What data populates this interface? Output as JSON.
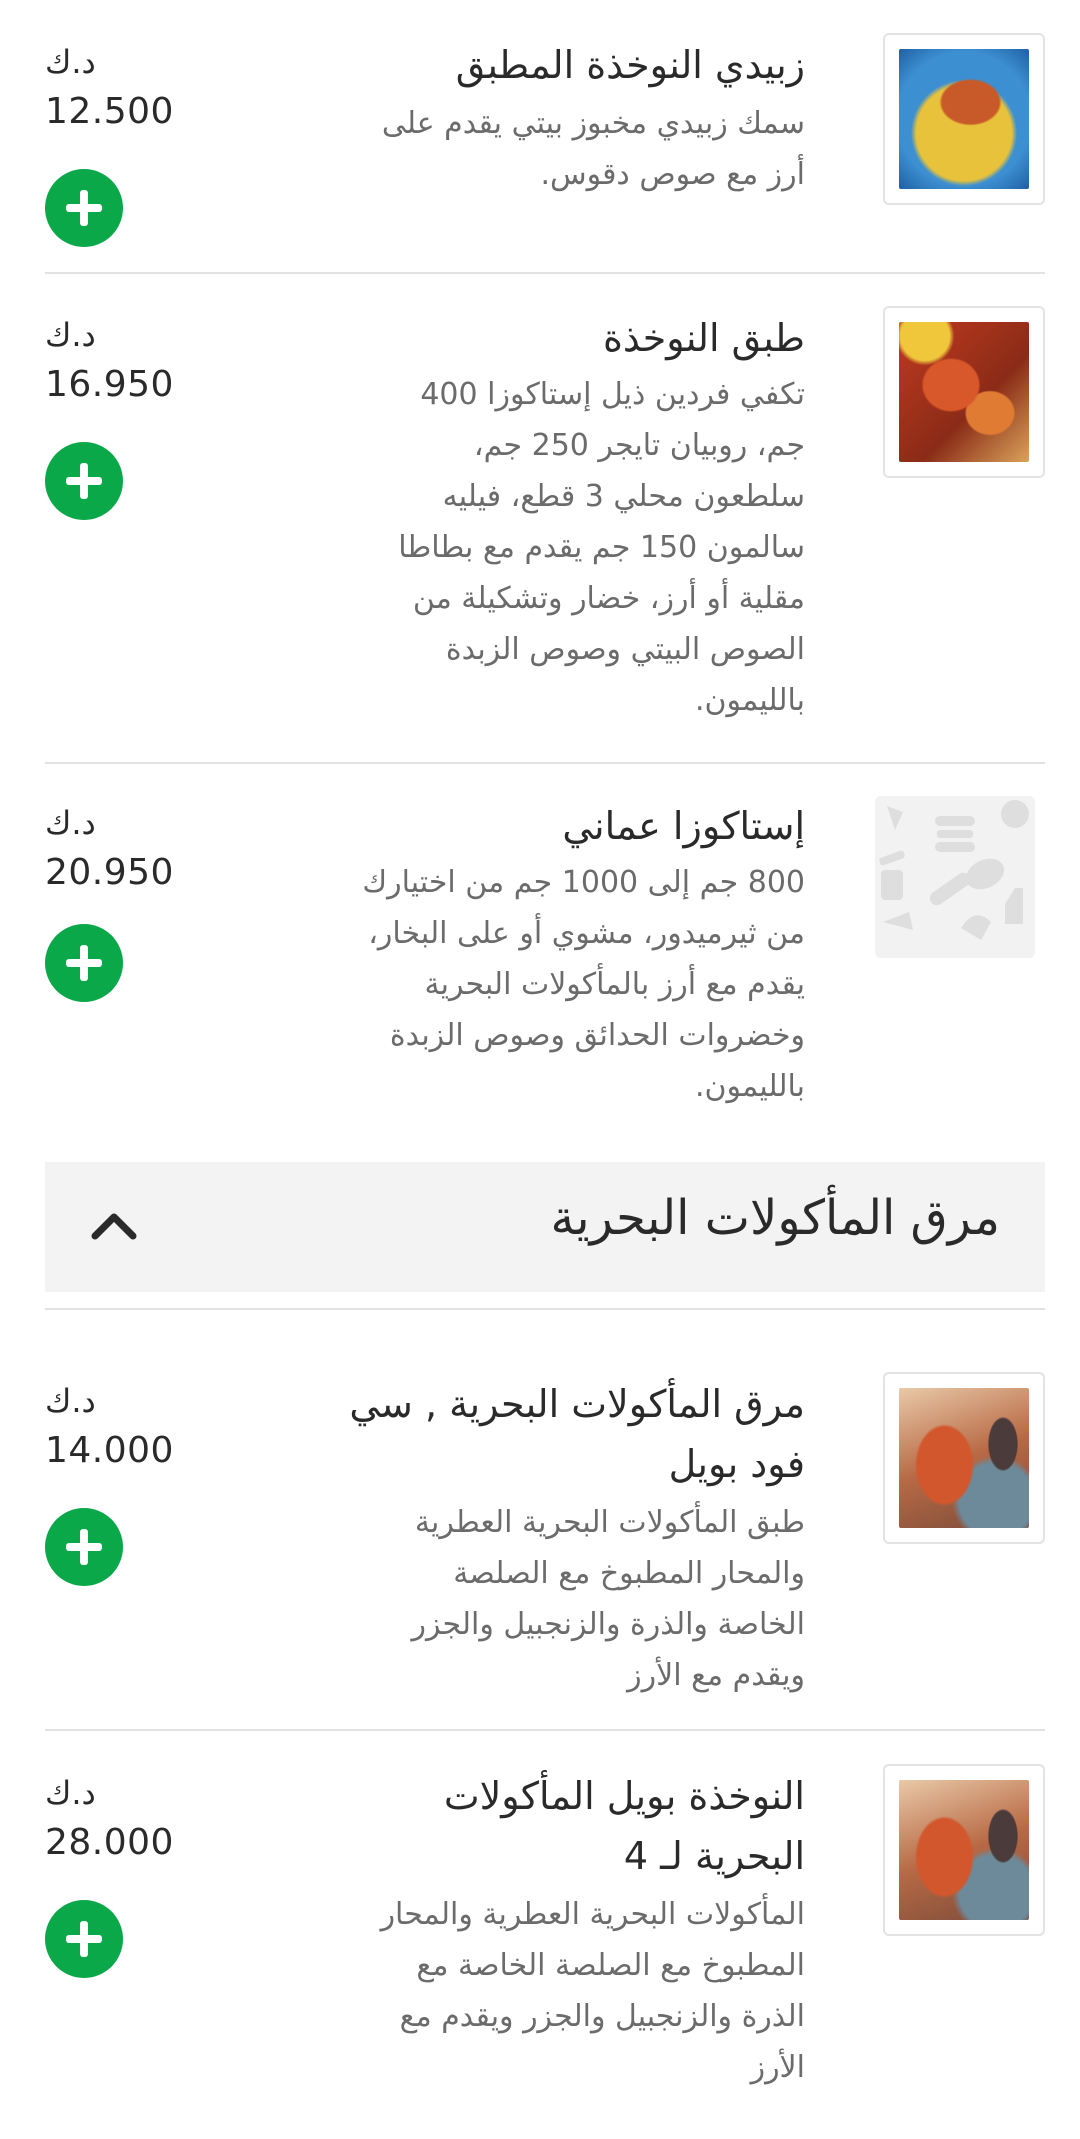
{
  "menu": {
    "items_top": [
      {
        "name": "زبيدي النوخذة المطبق",
        "description_lines": [
          "سمك زبيدي مخبوز بيتي يقدم على",
          "أرز مع صوص دقوس."
        ],
        "currency": "د.ك",
        "price": "12.500",
        "image": "grilled-fish-rice-photo"
      },
      {
        "name": "طبق النوخذة",
        "description_lines": [
          "تكفي فردين ذيل إستاكوزا 400",
          "جم، روبيان تايجر 250 جم،",
          "سلطعون محلي 3 قطع، فيليه",
          "سالمون 150 جم يقدم مع بطاطا",
          "مقلية أو أرز، خضار وتشكيلة من",
          "الصوص البيتي وصوص الزبدة",
          "بالليمون."
        ],
        "currency": "د.ك",
        "price": "16.950",
        "image": "seafood-platter-photo"
      },
      {
        "name": "إستاكوزا عماني",
        "description_lines": [
          "800 جم إلى 1000 جم من اختيارك",
          "من ثيرميدور، مشوي أو على البخار،",
          "يقدم مع أرز بالمأكولات البحرية",
          "وخضروات الحدائق وصوص الزبدة",
          "بالليمون."
        ],
        "currency": "د.ك",
        "price": "20.950",
        "image": "placeholder-food-icons"
      }
    ],
    "section": {
      "title": "مرق المأكولات البحرية",
      "collapse_icon": "chevron-up-icon"
    },
    "items_section": [
      {
        "name_lines": [
          "مرق المأكولات البحرية , سي",
          "فود بويل"
        ],
        "description_lines": [
          "طبق المأكولات البحرية العطرية",
          "والمحار المطبوخ مع الصلصة",
          "الخاصة والذرة والزنجبيل والجزر",
          "ويقدم مع الأرز"
        ],
        "currency": "د.ك",
        "price": "14.000",
        "image": "seafood-boil-photo"
      },
      {
        "name_lines": [
          "النوخذة بويل المأكولات",
          "البحرية لـ 4"
        ],
        "description_lines": [
          "المأكولات البحرية العطرية والمحار",
          "المطبوخ مع الصلصة الخاصة مع",
          "الذرة والزنجبيل والجزر ويقدم مع",
          "الأرز"
        ],
        "currency": "د.ك",
        "price": "28.000",
        "image": "seafood-boil-photo"
      }
    ],
    "add_icon": "plus-icon",
    "colors": {
      "add_button": "#0ba84a",
      "section_bg": "#f3f3f3",
      "divider": "#e2e2e2"
    }
  }
}
